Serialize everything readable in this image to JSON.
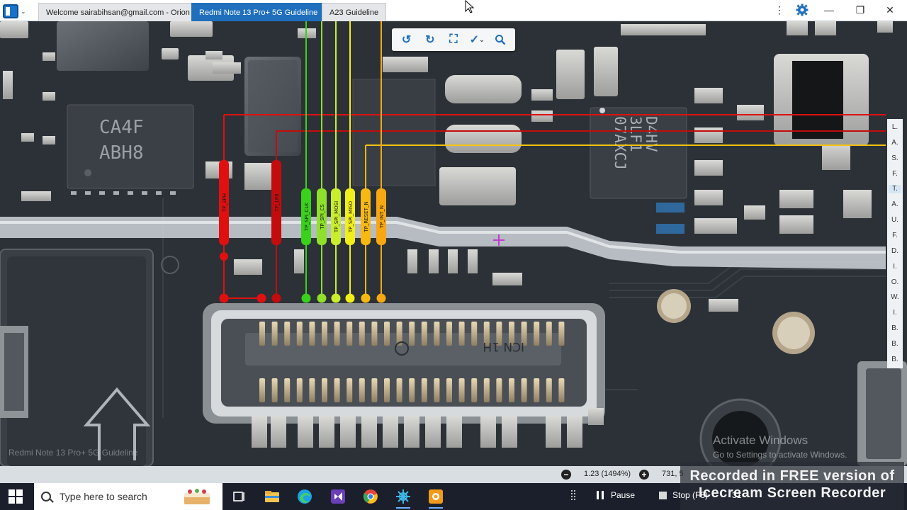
{
  "window": {
    "tabs": [
      {
        "label": "Welcome sairabihsan@gmail.com - Orion",
        "active": false
      },
      {
        "label": "Redmi Note 13 Pro+ 5G Guideline",
        "active": true
      },
      {
        "label": "A23 Guideline",
        "active": false
      }
    ],
    "controls": {
      "more": "⋮",
      "settings_icon": "gear-icon",
      "minimize": "—",
      "restore": "❐",
      "close": "✕"
    }
  },
  "toolbar": {
    "tools": [
      "rotate-left-icon",
      "rotate-right-icon",
      "fit-screen-icon",
      "select-tool-icon",
      "search-icon"
    ]
  },
  "board": {
    "label": "Redmi Note 13 Pro+ 5G Guideline",
    "chip_markings": {
      "left_chip": [
        "CA4F",
        "ABH8"
      ],
      "right_chip": [
        "D4HV",
        "3LF1",
        "07AXCJ"
      ],
      "connector": "ICN 1H"
    },
    "test_points": [
      {
        "name": "TP_3PH",
        "color": "#e01010"
      },
      {
        "name": "TP_1P8",
        "color": "#c40c0c"
      },
      {
        "name": "TP_SPI_CLK",
        "color": "#3ad11b"
      },
      {
        "name": "TP_SPI_CS",
        "color": "#8fe02a"
      },
      {
        "name": "TP_SPI_MOSI",
        "color": "#c8ee2e"
      },
      {
        "name": "TP_SPI_MISO",
        "color": "#f2ee1a"
      },
      {
        "name": "TP_RESET_N",
        "color": "#f7b812"
      },
      {
        "name": "TP_INT_N",
        "color": "#f7a712"
      }
    ],
    "side_panel_letters": [
      "L",
      "A",
      "S",
      "F",
      "T",
      "A",
      "U",
      "F",
      "D",
      "I",
      "O",
      "W",
      "I",
      "B",
      "B",
      "B"
    ],
    "side_panel_selected_index": 4
  },
  "status": {
    "zoom": "1.23 (1494%)",
    "coords": "731, 5"
  },
  "watermark": {
    "line1": "Activate Windows",
    "line2": "Go to Settings to activate Windows."
  },
  "taskbar": {
    "search_placeholder": "Type here to search",
    "apps": [
      "task-view-icon",
      "file-explorer-icon",
      "edge-icon",
      "visual-studio-icon",
      "chrome-icon",
      "orion-app-icon",
      "icecream-recorder-icon"
    ]
  },
  "recorder": {
    "banner_line1": "Recorded in FREE version of",
    "banner_line2": "Icecream Screen Recorder",
    "pause_label": "Pause",
    "stop_label": "Stop (F8)",
    "timer": "31"
  }
}
